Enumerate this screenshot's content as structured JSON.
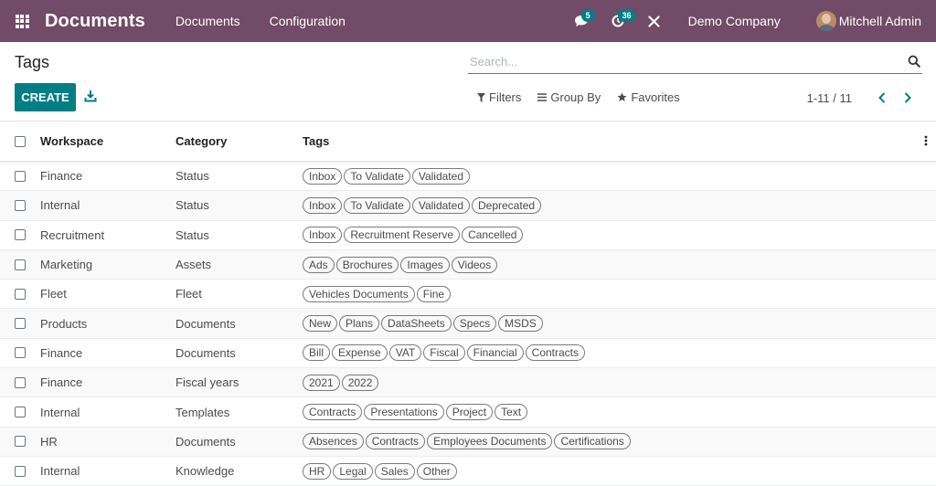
{
  "navbar": {
    "brand": "Documents",
    "menu": [
      {
        "label": "Documents"
      },
      {
        "label": "Configuration"
      }
    ],
    "messages_count": "5",
    "activities_count": "36",
    "company": "Demo Company",
    "user": "Mitchell Admin"
  },
  "control": {
    "title": "Tags",
    "create_label": "CREATE",
    "search_placeholder": "Search...",
    "filters_label": "Filters",
    "groupby_label": "Group By",
    "favorites_label": "Favorites",
    "pager_value": "1-11 / 11"
  },
  "table": {
    "columns": [
      "Workspace",
      "Category",
      "Tags"
    ],
    "rows": [
      {
        "workspace": "Finance",
        "category": "Status",
        "tags": [
          "Inbox",
          "To Validate",
          "Validated"
        ]
      },
      {
        "workspace": "Internal",
        "category": "Status",
        "tags": [
          "Inbox",
          "To Validate",
          "Validated",
          "Deprecated"
        ]
      },
      {
        "workspace": "Recruitment",
        "category": "Status",
        "tags": [
          "Inbox",
          "Recruitment Reserve",
          "Cancelled"
        ]
      },
      {
        "workspace": "Marketing",
        "category": "Assets",
        "tags": [
          "Ads",
          "Brochures",
          "Images",
          "Videos"
        ]
      },
      {
        "workspace": "Fleet",
        "category": "Fleet",
        "tags": [
          "Vehicles Documents",
          "Fine"
        ]
      },
      {
        "workspace": "Products",
        "category": "Documents",
        "tags": [
          "New",
          "Plans",
          "DataSheets",
          "Specs",
          "MSDS"
        ]
      },
      {
        "workspace": "Finance",
        "category": "Documents",
        "tags": [
          "Bill",
          "Expense",
          "VAT",
          "Fiscal",
          "Financial",
          "Contracts"
        ]
      },
      {
        "workspace": "Finance",
        "category": "Fiscal years",
        "tags": [
          "2021",
          "2022"
        ]
      },
      {
        "workspace": "Internal",
        "category": "Templates",
        "tags": [
          "Contracts",
          "Presentations",
          "Project",
          "Text"
        ]
      },
      {
        "workspace": "HR",
        "category": "Documents",
        "tags": [
          "Absences",
          "Contracts",
          "Employees Documents",
          "Certifications"
        ]
      },
      {
        "workspace": "Internal",
        "category": "Knowledge",
        "tags": [
          "HR",
          "Legal",
          "Sales",
          "Other"
        ]
      }
    ]
  },
  "colors": {
    "navbar": "#714b67",
    "primary": "#017e84",
    "badge": "#017e84"
  }
}
